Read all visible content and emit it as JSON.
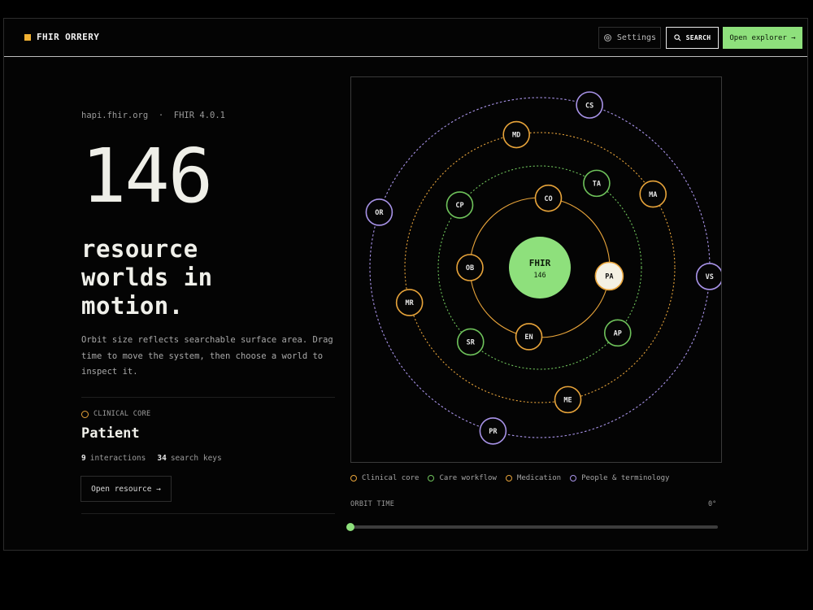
{
  "header": {
    "brand": "FHIR ORRERY",
    "settings_label": "Settings",
    "search_label": "SEARCH",
    "explorer_label": "Open explorer →"
  },
  "hero": {
    "host": "hapi.fhir.org  ·  FHIR 4.0.1",
    "count": "146",
    "headline_lines": [
      "resource",
      "worlds in",
      "motion."
    ],
    "description": "Orbit size reflects searchable surface area. Drag time to move the system, then choose a world to inspect it."
  },
  "selected": {
    "category": "CLINICAL CORE",
    "name": "Patient",
    "interactions_count": "9",
    "interactions_label": "interactions",
    "search_keys_count": "34",
    "search_keys_label": "search keys",
    "open_label": "Open resource →"
  },
  "orrery": {
    "center_label": "FHIR",
    "center_count": "146",
    "planets": [
      {
        "code": "CO",
        "category": "clinical"
      },
      {
        "code": "PA",
        "category": "clinical",
        "selected": true
      },
      {
        "code": "EN",
        "category": "clinical"
      },
      {
        "code": "OB",
        "category": "clinical"
      },
      {
        "code": "TA",
        "category": "care"
      },
      {
        "code": "CP",
        "category": "care"
      },
      {
        "code": "AP",
        "category": "care"
      },
      {
        "code": "SR",
        "category": "care"
      },
      {
        "code": "MD",
        "category": "medication"
      },
      {
        "code": "MA",
        "category": "medication"
      },
      {
        "code": "MR",
        "category": "medication"
      },
      {
        "code": "ME",
        "category": "medication"
      },
      {
        "code": "CS",
        "category": "people"
      },
      {
        "code": "OR",
        "category": "people"
      },
      {
        "code": "VS",
        "category": "people"
      },
      {
        "code": "PR",
        "category": "people"
      }
    ]
  },
  "legend": [
    {
      "label": "Clinical core",
      "color": "#e8a43a"
    },
    {
      "label": "Care workflow",
      "color": "#6fc35b"
    },
    {
      "label": "Medication",
      "color": "#e8a43a"
    },
    {
      "label": "People & terminology",
      "color": "#a893e8"
    }
  ],
  "colors": {
    "clinical": "#e8a43a",
    "care": "#6fc35b",
    "medication": "#e8a43a",
    "people": "#a893e8",
    "accent_green": "#8ee07c",
    "brand_square": "#f2b233"
  },
  "timeline": {
    "label": "ORBIT TIME",
    "value": "0°",
    "progress": 0
  }
}
